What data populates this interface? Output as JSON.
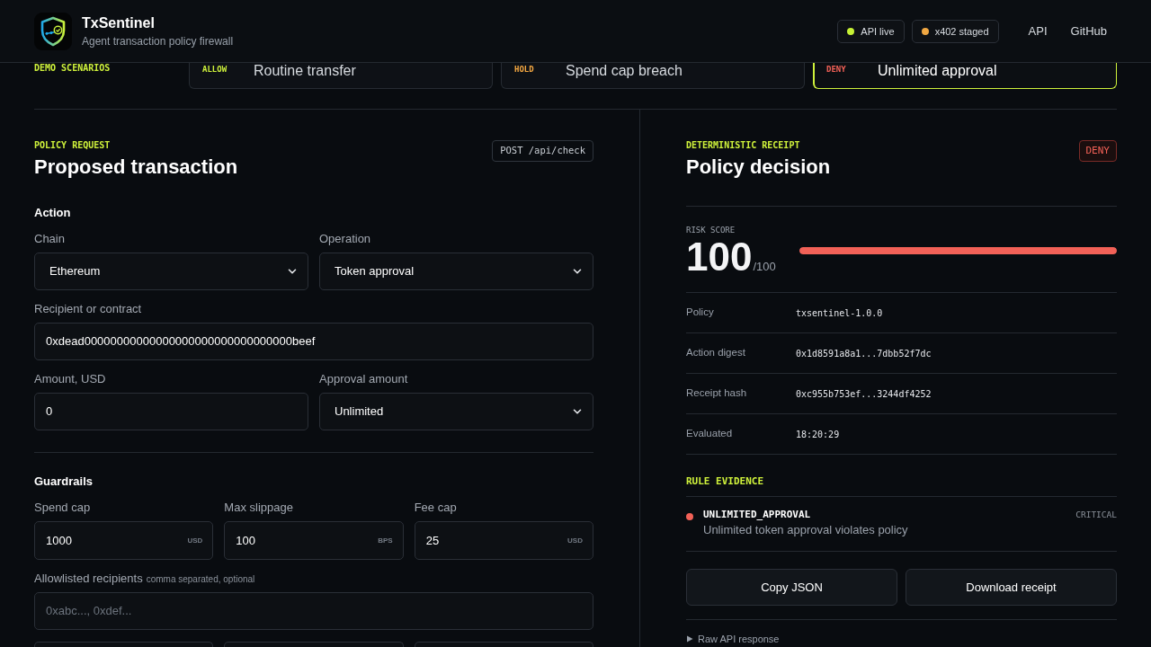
{
  "header": {
    "title": "TxSentinel",
    "subtitle": "Agent transaction policy firewall",
    "status_pills": [
      {
        "label": "API live",
        "color": "#c6f135"
      },
      {
        "label": "x402 staged",
        "color": "#f0a742"
      }
    ],
    "nav_links": [
      "API",
      "GitHub"
    ]
  },
  "scenarios": {
    "label": "DEMO SCENARIOS",
    "items": [
      {
        "verdict": "ALLOW",
        "title": "Routine transfer",
        "color": "#cff23b",
        "selected": false
      },
      {
        "verdict": "HOLD",
        "title": "Spend cap breach",
        "color": "#f4a741",
        "selected": false
      },
      {
        "verdict": "DENY",
        "title": "Unlimited approval",
        "color": "#f26157",
        "selected": true
      }
    ]
  },
  "request": {
    "eyebrow": "POLICY REQUEST",
    "title": "Proposed transaction",
    "endpoint": "POST /api/check",
    "sections": [
      {
        "title": "Action",
        "rows": [
          [
            {
              "kind": "select",
              "label": "Chain",
              "value": "Ethereum"
            },
            {
              "kind": "select",
              "label": "Operation",
              "value": "Token approval"
            }
          ],
          [
            {
              "kind": "input",
              "label": "Recipient or contract",
              "value": "0xdead00000000000000000000000000000000beef"
            }
          ],
          [
            {
              "kind": "input",
              "label": "Amount, USD",
              "value": "0"
            },
            {
              "kind": "select",
              "label": "Approval amount",
              "value": "Unlimited"
            }
          ]
        ]
      },
      {
        "title": "Guardrails",
        "rows": [
          [
            {
              "kind": "unit_input",
              "label": "Spend cap",
              "value": "1000",
              "unit": "USD"
            },
            {
              "kind": "unit_input",
              "label": "Max slippage",
              "value": "100",
              "unit": "BPS"
            },
            {
              "kind": "unit_input",
              "label": "Fee cap",
              "value": "25",
              "unit": "USD"
            }
          ],
          [
            {
              "kind": "input",
              "label": "Allowlisted recipients",
              "hint": "comma separated, optional",
              "placeholder": "0xabc..., 0xdef..."
            }
          ],
          [
            {
              "kind": "cut_off_input"
            },
            {
              "kind": "cut_off_input"
            },
            {
              "kind": "cut_off_input"
            }
          ]
        ]
      }
    ]
  },
  "decision": {
    "eyebrow": "DETERMINISTIC RECEIPT",
    "title": "Policy decision",
    "verdict": "DENY",
    "risk": {
      "label": "RISK SCORE",
      "score": "100",
      "max": "/100",
      "level": 1.0
    },
    "details": [
      {
        "label": "Policy",
        "value": "txsentinel-1.0.0"
      },
      {
        "label": "Action digest",
        "value": "0x1d8591a8a1...7dbb52f7dc"
      },
      {
        "label": "Receipt hash",
        "value": "0xc955b753ef...3244df4252"
      },
      {
        "label": "Evaluated",
        "value": "18:20:29"
      }
    ],
    "evidence": {
      "title": "RULE EVIDENCE",
      "items": [
        {
          "code": "UNLIMITED_APPROVAL",
          "severity": "CRITICAL",
          "message": "Unlimited token approval violates policy",
          "color": "#f26157"
        }
      ]
    },
    "actions": [
      "Copy JSON",
      "Download receipt"
    ],
    "raw_toggle": {
      "label": "Raw API response",
      "expanded": false
    }
  }
}
